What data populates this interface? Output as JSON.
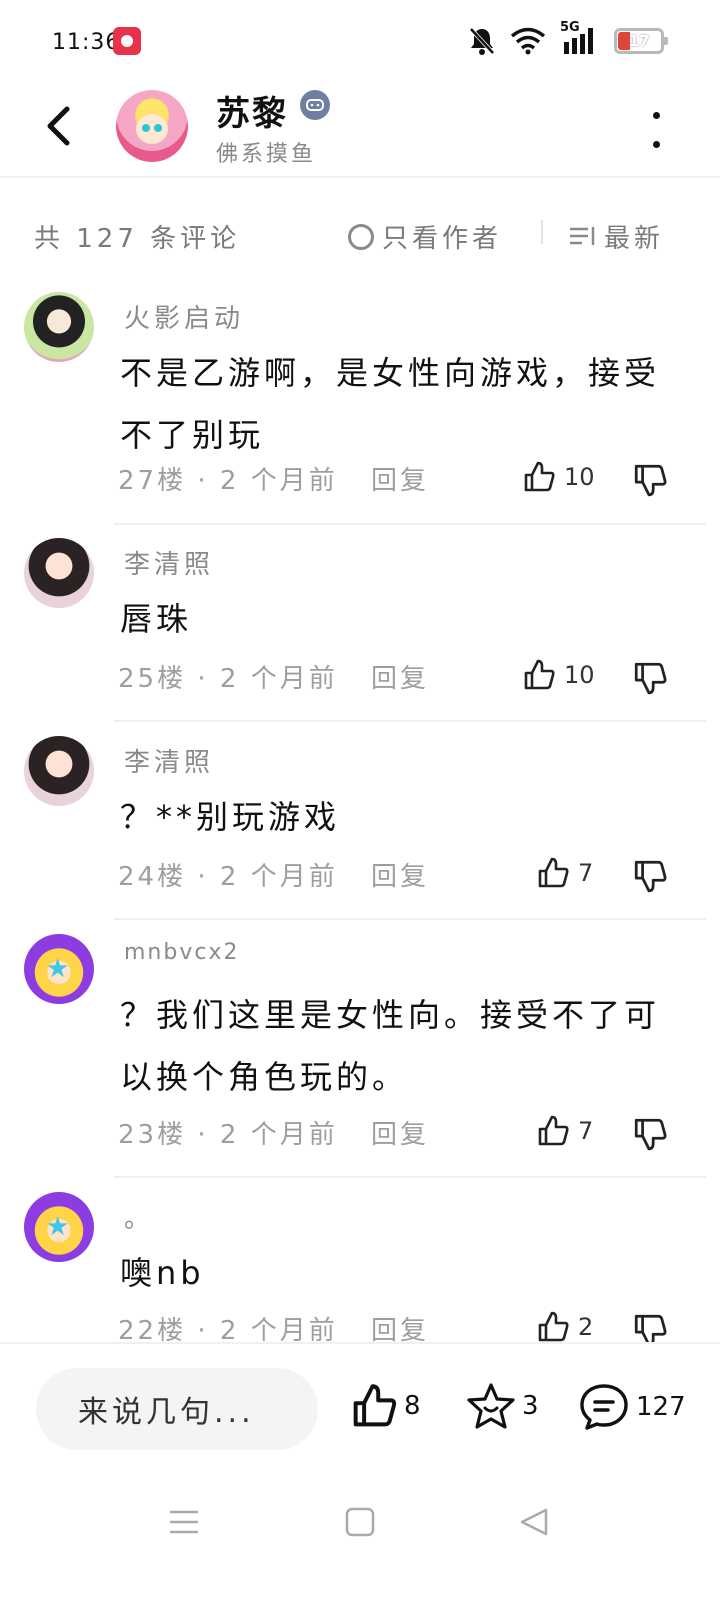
{
  "status_bar": {
    "time": "11:36",
    "network": "5G",
    "battery": "17",
    "colors": {
      "battery_low": "#e0453b",
      "app_badge": "#e8324c"
    },
    "icons": [
      "app-badge-icon",
      "mute-bell-icon",
      "wifi-icon",
      "signal-icon",
      "battery-icon"
    ]
  },
  "header": {
    "author_name": "苏黎",
    "author_subtitle": "佛系摸鱼",
    "icons": [
      "back-arrow-icon",
      "verified-badge-icon",
      "more-vertical-icon"
    ]
  },
  "filter": {
    "comment_count": "共 127 条评论",
    "author_only_label": "只看作者",
    "sort_label": "最新",
    "icons": [
      "radio-circle-icon",
      "sort-lines-icon"
    ]
  },
  "comments": [
    {
      "user": "火影启动",
      "text": "不是乙游啊，是女性向游戏，接受不了别玩",
      "floor": "27楼",
      "time": "· 2 个月前",
      "reply": "回复",
      "likes": "10"
    },
    {
      "user": "李清照",
      "text": "唇珠",
      "floor": "25楼",
      "time": "· 2 个月前",
      "reply": "回复",
      "likes": "10"
    },
    {
      "user": "李清照",
      "text": "？**别玩游戏",
      "floor": "24楼",
      "time": "· 2 个月前",
      "reply": "回复",
      "likes": "7"
    },
    {
      "user": "mnbvcx2",
      "text": "？我们这里是女性向。接受不了可以换个角色玩的。",
      "floor": "23楼",
      "time": "· 2 个月前",
      "reply": "回复",
      "likes": "7"
    },
    {
      "user": "。",
      "text": "噢nb",
      "floor": "22楼",
      "time": "· 2 个月前",
      "reply": "回复",
      "likes": "2"
    }
  ],
  "bottom_bar": {
    "input_placeholder": "来说几句...",
    "like_count": "8",
    "favorite_count": "3",
    "comment_count": "127",
    "icons": [
      "thumbs-up-icon",
      "star-icon",
      "comment-bubble-icon"
    ]
  },
  "nav_bar": {
    "icons": [
      "menu-icon",
      "home-square-icon",
      "back-triangle-icon"
    ]
  }
}
